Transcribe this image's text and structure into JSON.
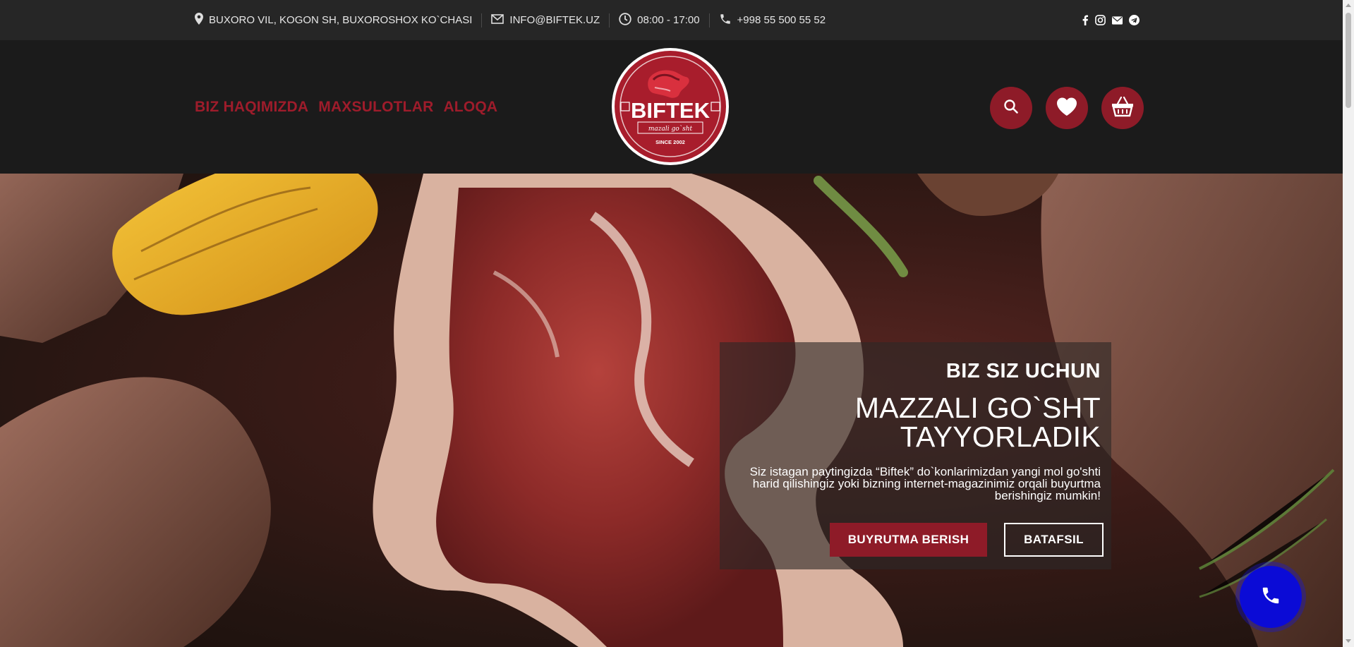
{
  "topbar": {
    "address": "BUXORO VIL, KOGON SH, BUXOROSHOX KO`CHASI",
    "email": "INFO@BIFTEK.UZ",
    "hours": "08:00 - 17:00",
    "phone": "+998 55 500 55 52",
    "social_icons": [
      "facebook-icon",
      "instagram-icon",
      "email-icon",
      "telegram-icon"
    ]
  },
  "nav": {
    "items": [
      {
        "label": "BIZ HAQIMIZDA"
      },
      {
        "label": "MAXSULOTLAR"
      },
      {
        "label": "ALOQA"
      }
    ]
  },
  "logo": {
    "brand": "BIFTEK",
    "tagline": "mazali go`sht",
    "since": "SINCE 2002"
  },
  "header_icons": [
    "search-icon",
    "heart-icon",
    "basket-icon"
  ],
  "hero": {
    "subtitle": "BIZ SIZ UCHUN",
    "title": "MAZZALI GO`SHT TAYYORLADIK",
    "text": "Siz istagan paytingizda “Biftek” do`konlarimizdan yangi mol go'shti harid qilishingiz yoki bizning internet-magazinimiz orqali buyurtma berishingiz mumkin!",
    "primary_button": "BUYRUTMA BERISH",
    "secondary_button": "BATAFSIL"
  },
  "colors": {
    "brand_red": "#8e1b28",
    "nav_red": "#9e1c2b",
    "topbar_bg": "#262626",
    "header_bg": "#1b1b1b",
    "call_button": "#0b0bd6"
  }
}
